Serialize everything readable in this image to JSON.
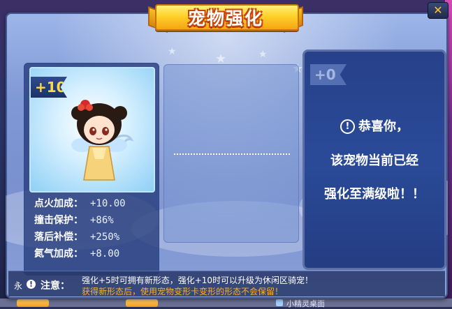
{
  "dialog": {
    "title": "宠物强化",
    "close_symbol": "✕"
  },
  "pet_card": {
    "level_badge": "+10"
  },
  "stats": [
    {
      "label": "点火加成：",
      "value": "+10.00"
    },
    {
      "label": "撞击保护：",
      "value": "+86%"
    },
    {
      "label": "落后补偿：",
      "value": "+250%"
    },
    {
      "label": "氮气加成：",
      "value": "+8.00"
    }
  ],
  "result_panel": {
    "ghost_badge": "+0",
    "info_symbol": "!",
    "line1": "恭喜你，",
    "line2": "该宠物当前已经",
    "line3": "强化至满级啦！！"
  },
  "notice": {
    "side_text": "永",
    "icon_symbol": "!",
    "label": "注意：",
    "line1": "强化+5时可拥有新形态，强化+10时可以升级为休闲区骑宠！",
    "line2": "获得新形态后，使用宠物变形卡变形的形态不会保留！"
  },
  "background": {
    "bottom_text": "小精灵桌面"
  },
  "colors": {
    "title_fill": "#ffd02a",
    "level_text": "#ffd84a",
    "notice_highlight": "#ffb020",
    "close_accent": "#ffc72a"
  },
  "icons": [
    "close-icon",
    "info-icon",
    "warning-icon",
    "star-icon"
  ]
}
